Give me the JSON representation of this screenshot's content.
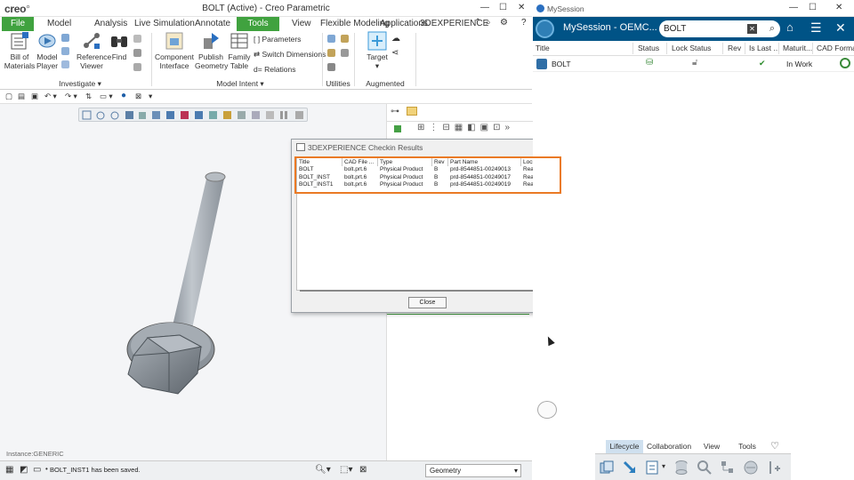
{
  "creo": {
    "logo": "creo",
    "title": "BOLT (Active) - Creo Parametric",
    "tabs": [
      "File",
      "Model",
      "Analysis",
      "Live Simulation",
      "Annotate",
      "Tools",
      "View",
      "Flexible Modeling",
      "Applications",
      "3DEXPERIENCE"
    ],
    "active_tab": "Tools",
    "ribbon": {
      "buttons": [
        {
          "name": "bill-of-materials",
          "label": "Bill of\nMaterials"
        },
        {
          "name": "model-player",
          "label": "Model\nPlayer"
        },
        {
          "name": "reference-viewer",
          "label": "Reference\nViewer"
        },
        {
          "name": "find",
          "label": "Find"
        },
        {
          "name": "component-interface",
          "label": "Component\nInterface"
        },
        {
          "name": "publish-geometry",
          "label": "Publish\nGeometry"
        },
        {
          "name": "family-table",
          "label": "Family\nTable"
        },
        {
          "name": "target",
          "label": "Target"
        }
      ],
      "small_items": [
        "Parameters",
        "Switch Dimensions",
        "Relations"
      ],
      "groups": [
        "Investigate",
        "Model Intent",
        "Utilities",
        "Augmented Reality"
      ]
    },
    "instance_label": "Instance:GENERIC",
    "status_message": "BOLT_INST1 has been saved.",
    "filter_value": "Geometry"
  },
  "dialog": {
    "title": "3DEXPERIENCE Checkin Results",
    "columns": [
      "Title",
      "CAD File ...",
      "Type",
      "Rev",
      "Part Name",
      "Lock Status"
    ],
    "rows": [
      [
        "BOLT",
        "bolt.prt.6",
        "Physical Product",
        "B",
        "prd-8544851-00249013",
        "Read Only"
      ],
      [
        "BOLT_INST",
        "bolt.prt.6",
        "Physical Product",
        "B",
        "prd-8544851-00249017",
        "Read Only"
      ],
      [
        "BOLT_INST1",
        "bolt.prt.6",
        "Physical Product",
        "B",
        "prd-8544851-00249019",
        "Read Only"
      ]
    ],
    "close_label": "Close",
    "highlight_color": "#ea7a25"
  },
  "mysession": {
    "window_title": "MySession",
    "header_name": "MySession - OEMC...",
    "search_value": "BOLT",
    "header_color": "#005386",
    "columns": [
      "Title",
      "Status",
      "Lock Status",
      "Rev",
      "Is Last ...",
      "Maturit...",
      "CAD Format"
    ],
    "row": {
      "title": "BOLT",
      "is_last_icon": "check-icon",
      "maturity": "In Work"
    },
    "bottom_tabs": [
      "Lifecycle",
      "Collaboration",
      "View",
      "Tools"
    ],
    "active_bottom_tab": "Lifecycle"
  }
}
